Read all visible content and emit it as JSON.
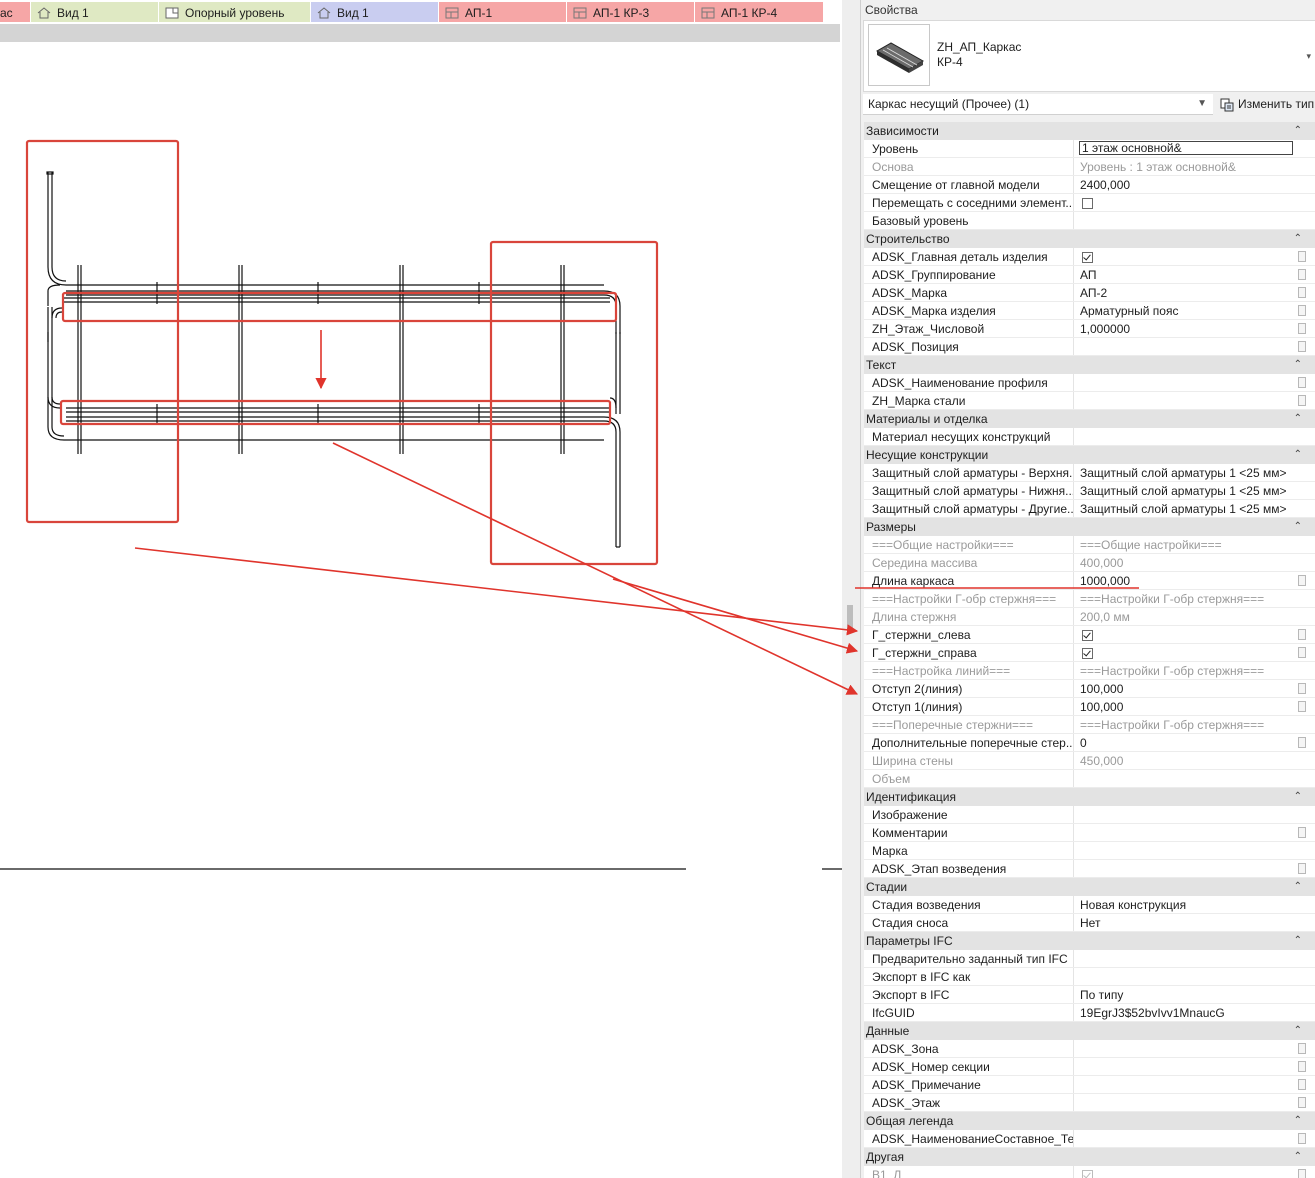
{
  "tabs": [
    {
      "label": "ас",
      "color": "#f6a6a6",
      "icon": "sheet-icon"
    },
    {
      "label": "Вид 1",
      "color": "#dfe9c3",
      "icon": "house-icon"
    },
    {
      "label": "Опорный уровень",
      "color": "#dfe9c3",
      "icon": "plan-icon"
    },
    {
      "label": "Вид 1",
      "color": "#c9cdf0",
      "icon": "house-icon"
    },
    {
      "label": "АП-1",
      "color": "#f6a6a6",
      "icon": "sheet-icon"
    },
    {
      "label": "АП-1 КР-3",
      "color": "#f6a6a6",
      "icon": "sheet-icon"
    },
    {
      "label": "АП-1 КР-4",
      "color": "#f6a6a6",
      "icon": "sheet-icon"
    }
  ],
  "properties": {
    "title": "Свойства",
    "type_name_line1": "ZH_АП_Каркас",
    "type_name_line2": "КР-4",
    "filter": "Каркас несущий (Прочее) (1)",
    "edit_type": "Изменить тип"
  },
  "groups": [
    {
      "title": "Зависимости",
      "rows": [
        {
          "name": "Уровень",
          "value": "1 этаж основной&",
          "boxed": true
        },
        {
          "name": "Основа",
          "value": "Уровень : 1 этаж основной&",
          "disabled": true
        },
        {
          "name": "Смещение от главной модели",
          "value": "2400,000"
        },
        {
          "name": "Перемещать с соседними элемент...",
          "check": "off"
        },
        {
          "name": "Базовый уровень",
          "value": ""
        }
      ]
    },
    {
      "title": "Строительство",
      "rows": [
        {
          "name": "ADSK_Главная деталь изделия",
          "check": "on",
          "fx": true
        },
        {
          "name": "ADSK_Группирование",
          "value": "АП",
          "fx": true
        },
        {
          "name": "ADSK_Марка",
          "value": "АП-2",
          "fx": true
        },
        {
          "name": "ADSK_Марка изделия",
          "value": "Арматурный пояс",
          "fx": true
        },
        {
          "name": "ZH_Этаж_Числовой",
          "value": "1,000000",
          "fx": true
        },
        {
          "name": "ADSK_Позиция",
          "value": "",
          "fx": true
        }
      ]
    },
    {
      "title": "Текст",
      "rows": [
        {
          "name": "ADSK_Наименование профиля",
          "value": "",
          "fx": true
        },
        {
          "name": "ZH_Марка стали",
          "value": "",
          "fx": true
        }
      ]
    },
    {
      "title": "Материалы и отделка",
      "rows": [
        {
          "name": "Материал несущих конструкций",
          "value": ""
        }
      ]
    },
    {
      "title": "Несущие конструкции",
      "rows": [
        {
          "name": "Защитный слой арматуры - Верхня...",
          "value": "Защитный слой арматуры 1 <25 мм>"
        },
        {
          "name": "Защитный слой арматуры - Нижня...",
          "value": "Защитный слой арматуры 1 <25 мм>"
        },
        {
          "name": "Защитный слой арматуры - Другие...",
          "value": "Защитный слой арматуры 1 <25 мм>"
        }
      ]
    },
    {
      "title": "Размеры",
      "rows": [
        {
          "name": "===Общие настройки===",
          "value": "===Общие настройки===",
          "disabled": true
        },
        {
          "name": "Середина массива",
          "value": "400,000",
          "disabled": true
        },
        {
          "name": "Длина каркаса",
          "value": "1000,000",
          "fx": true
        },
        {
          "name": "===Настройки Г-обр стержня===",
          "value": "===Настройки Г-обр стержня===",
          "disabled": true
        },
        {
          "name": "Длина стержня",
          "value": "200,0 мм",
          "disabled": true
        },
        {
          "name": "Г_стержни_слева",
          "check": "on",
          "fx": true
        },
        {
          "name": "Г_стержни_справа",
          "check": "on",
          "fx": true
        },
        {
          "name": "===Настройка линий===",
          "value": "===Настройки Г-обр стержня===",
          "disabled": true
        },
        {
          "name": "Отступ 2(линия)",
          "value": "100,000",
          "fx": true
        },
        {
          "name": "Отступ 1(линия)",
          "value": "100,000",
          "fx": true
        },
        {
          "name": "===Поперечные стержни===",
          "value": "===Настройки Г-обр стержня===",
          "disabled": true
        },
        {
          "name": "Дополнительные поперечные стер...",
          "value": "0",
          "fx": true
        },
        {
          "name": "Ширина стены",
          "value": "450,000",
          "disabled": true
        },
        {
          "name": "Объем",
          "value": "",
          "disabled": true
        }
      ]
    },
    {
      "title": "Идентификация",
      "rows": [
        {
          "name": "Изображение",
          "value": ""
        },
        {
          "name": "Комментарии",
          "value": "",
          "fx": true
        },
        {
          "name": "Марка",
          "value": ""
        },
        {
          "name": "ADSK_Этап возведения",
          "value": "",
          "fx": true
        }
      ]
    },
    {
      "title": "Стадии",
      "rows": [
        {
          "name": "Стадия возведения",
          "value": "Новая конструкция"
        },
        {
          "name": "Стадия сноса",
          "value": "Нет"
        }
      ]
    },
    {
      "title": "Параметры IFC",
      "rows": [
        {
          "name": "Предварительно заданный тип IFC",
          "value": ""
        },
        {
          "name": "Экспорт в IFC как",
          "value": ""
        },
        {
          "name": "Экспорт в IFC",
          "value": "По типу"
        },
        {
          "name": "IfcGUID",
          "value": "19EgrJ3$52bvIvv1MnaucG"
        }
      ]
    },
    {
      "title": "Данные",
      "rows": [
        {
          "name": "ADSK_Зона",
          "value": "",
          "fx": true
        },
        {
          "name": "ADSK_Номер секции",
          "value": "",
          "fx": true
        },
        {
          "name": "ADSK_Примечание",
          "value": "",
          "fx": true
        },
        {
          "name": "ADSK_Этаж",
          "value": "",
          "fx": true
        }
      ]
    },
    {
      "title": "Общая легенда",
      "rows": [
        {
          "name": "ADSK_НаименованиеСоставное_Те...",
          "value": "",
          "fx": true
        }
      ]
    },
    {
      "title": "Другая",
      "rows": [
        {
          "name": "В1_Л",
          "check": "on",
          "disabled": true,
          "fx": true
        }
      ]
    }
  ],
  "colors": {
    "annotation": "#e0342c",
    "selection_box": "#d9453b"
  }
}
